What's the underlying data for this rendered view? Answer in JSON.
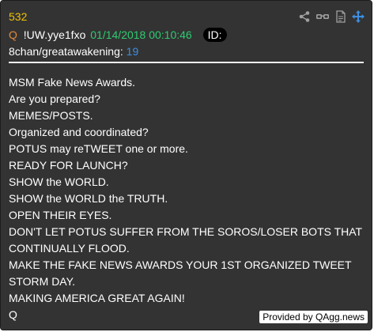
{
  "post": {
    "number": "532",
    "author_letter": "Q",
    "tripcode": "!UW.yye1fxo",
    "timestamp": "01/14/2018 00:10:46",
    "id_label": "ID:",
    "board": "8chan/greatawakening:",
    "board_post_count": "19"
  },
  "body_lines": [
    "MSM Fake News Awards.",
    "Are you prepared?",
    "MEMES/POSTS.",
    "Organized and coordinated?",
    "POTUS may reTWEET one or more.",
    "READY FOR LAUNCH?",
    "SHOW the WORLD.",
    "SHOW the WORLD the TRUTH.",
    "OPEN THEIR EYES.",
    "DON'T LET POTUS SUFFER FROM THE SOROS/LOSER BOTS THAT CONTINUALLY FLOOD.",
    "MAKE THE FAKE NEWS AWARDS YOUR 1ST ORGANIZED TWEET STORM DAY.",
    "MAKING AMERICA GREAT AGAIN!",
    "Q"
  ],
  "credit": "Provided by QAgg.news",
  "icons": [
    "share-icon",
    "glasses-icon",
    "document-icon",
    "move-icon"
  ],
  "colors": {
    "background": "#333333",
    "post_number": "#f2c200",
    "author_letter": "#e08a3c",
    "timestamp": "#2ecc71",
    "board_number": "#3d8fe0",
    "move_icon": "#3d8fe0"
  }
}
